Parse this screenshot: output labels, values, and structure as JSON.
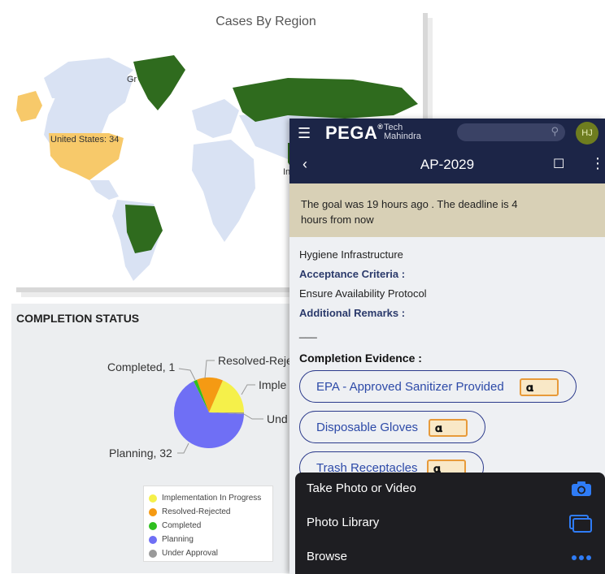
{
  "map": {
    "title": "Cases By Region",
    "labels": {
      "greenland": "Gr",
      "united_states": "United States: 34",
      "india_partial": "In"
    }
  },
  "status": {
    "title": "COMPLETION STATUS",
    "slice_labels": {
      "completed": "Completed, 1",
      "resolved": "Resolved-Reje",
      "implementation": "Imple",
      "under": "Und",
      "planning": "Planning, 32"
    },
    "legend": [
      {
        "label": "Implementation In Progress",
        "color": "#f5f04a"
      },
      {
        "label": "Resolved-Rejected",
        "color": "#f59a13"
      },
      {
        "label": "Completed",
        "color": "#2fbf1f"
      },
      {
        "label": "Planning",
        "color": "#6f6ff5"
      },
      {
        "label": "Under Approval",
        "color": "#9a9a9a"
      }
    ]
  },
  "phone": {
    "brand": "PEGA",
    "brand_sup": "®",
    "partner_line1": "Tech",
    "partner_line2": "Mahindra",
    "avatar_initials": "HJ",
    "case_id": "AP-2029",
    "goal_text": "The goal was 19 hours ago . The deadline is 4 hours from now",
    "description": "Hygiene Infrastructure",
    "acceptance_label": "Acceptance Criteria :",
    "acceptance_value": "Ensure Availability Protocol",
    "remarks_label": "Additional Remarks :",
    "remarks_value": "___",
    "evidence_title": "Completion Evidence :",
    "evidence_items": [
      "EPA - Approved Sanitizer Provided",
      "Disposable Gloves",
      "Trash Receptacles"
    ],
    "sheet_items": [
      "Take Photo or Video",
      "Photo Library",
      "Browse"
    ]
  },
  "colors": {
    "header_navy": "#1c2547",
    "map_green": "#2f6b1e",
    "map_yellow": "#f7c96a",
    "map_base": "#d9e2f3",
    "accent_orange": "#e79a3a",
    "ios_blue": "#2f7cf6"
  }
}
